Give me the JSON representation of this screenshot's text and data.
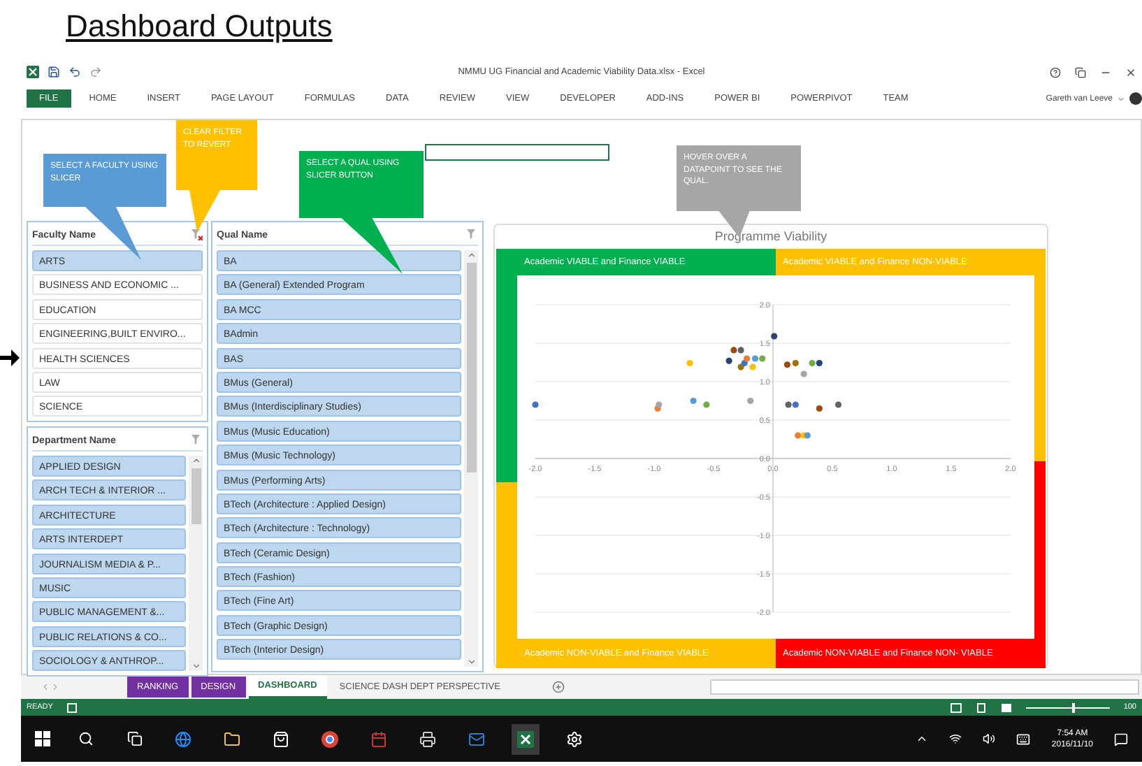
{
  "slide_title": "Dashboard Outputs",
  "window": {
    "title": "NMMU UG Financial and Academic Viability Data.xlsx - Excel",
    "user": "Gareth van Leeve"
  },
  "ribbon_tabs": [
    {
      "label": "FILE",
      "selected": true
    },
    {
      "label": "HOME",
      "selected": false
    },
    {
      "label": "INSERT",
      "selected": false
    },
    {
      "label": "PAGE LAYOUT",
      "selected": false
    },
    {
      "label": "FORMULAS",
      "selected": false
    },
    {
      "label": "DATA",
      "selected": false
    },
    {
      "label": "REVIEW",
      "selected": false
    },
    {
      "label": "VIEW",
      "selected": false
    },
    {
      "label": "DEVELOPER",
      "selected": false
    },
    {
      "label": "ADD-INS",
      "selected": false
    },
    {
      "label": "POWER BI",
      "selected": false
    },
    {
      "label": "POWERPIVOT",
      "selected": false
    },
    {
      "label": "TEAM",
      "selected": false
    }
  ],
  "callouts": [
    {
      "text": "SELECT A FACULTY USING SLICER",
      "color": "#5b9bd5"
    },
    {
      "text": "CLEAR FILTER TO REVERT",
      "color": "#ffc000"
    },
    {
      "text": "SELECT A QUAL USING SLICER BUTTON",
      "color": "#00b050"
    },
    {
      "text": "HOVER OVER A DATAPOINT TO SEE THE QUAL.",
      "color": "#a6a6a6"
    }
  ],
  "slicers": [
    {
      "title": "Faculty Name",
      "filtered": true,
      "scrollable": false,
      "items": [
        {
          "label": "ARTS",
          "selected": true
        },
        {
          "label": "BUSINESS AND ECONOMIC ...",
          "selected": false
        },
        {
          "label": "EDUCATION",
          "selected": false
        },
        {
          "label": "ENGINEERING,BUILT ENVIRO...",
          "selected": false
        },
        {
          "label": "HEALTH SCIENCES",
          "selected": false
        },
        {
          "label": "LAW",
          "selected": false
        },
        {
          "label": "SCIENCE",
          "selected": false
        }
      ]
    },
    {
      "title": "Department Name",
      "filtered": false,
      "scrollable": true,
      "items": [
        {
          "label": "APPLIED DESIGN",
          "selected": true
        },
        {
          "label": "ARCH TECH & INTERIOR ...",
          "selected": true
        },
        {
          "label": "ARCHITECTURE",
          "selected": true
        },
        {
          "label": "ARTS INTERDEPT",
          "selected": true
        },
        {
          "label": "JOURNALISM MEDIA & P...",
          "selected": true
        },
        {
          "label": "MUSIC",
          "selected": true
        },
        {
          "label": "PUBLIC MANAGEMENT &...",
          "selected": true
        },
        {
          "label": "PUBLIC RELATIONS & CO...",
          "selected": true
        },
        {
          "label": "SOCIOLOGY & ANTHROP...",
          "selected": true
        }
      ]
    },
    {
      "title": "Qual Name",
      "filtered": false,
      "scrollable": true,
      "items": [
        {
          "label": "BA",
          "selected": true
        },
        {
          "label": "BA (General) Extended Program",
          "selected": true
        },
        {
          "label": "BA MCC",
          "selected": true
        },
        {
          "label": "BAdmin",
          "selected": true
        },
        {
          "label": "BAS",
          "selected": true
        },
        {
          "label": "BMus (General)",
          "selected": true
        },
        {
          "label": "BMus (Interdisciplinary Studies)",
          "selected": true
        },
        {
          "label": "BMus (Music Education)",
          "selected": true
        },
        {
          "label": "BMus (Music Technology)",
          "selected": true
        },
        {
          "label": "BMus (Performing Arts)",
          "selected": true
        },
        {
          "label": "BTech (Architecture : Applied Design)",
          "selected": true
        },
        {
          "label": "BTech (Architecture : Technology)",
          "selected": true
        },
        {
          "label": "BTech (Ceramic Design)",
          "selected": true
        },
        {
          "label": "BTech (Fashion)",
          "selected": true
        },
        {
          "label": "BTech (Fine Art)",
          "selected": true
        },
        {
          "label": "BTech (Graphic Design)",
          "selected": true
        },
        {
          "label": "BTech (Interior Design)",
          "selected": true
        }
      ]
    }
  ],
  "chart": {
    "quadrants": [
      {
        "label": "Academic VIABLE and Finance VIABLE",
        "color": "#00b050"
      },
      {
        "label": "Academic VIABLE and Finance NON-VIABLE",
        "color": "#ffc000"
      },
      {
        "label": "Academic NON-VIABLE and Finance VIABLE",
        "color": "#ffc000"
      },
      {
        "label": "Academic NON-VIABLE and Finance NON- VIABLE",
        "color": "#ff0000"
      }
    ],
    "chart_data": {
      "type": "scatter",
      "title": "Programme Viability",
      "x": [
        -2.0,
        -0.97,
        -0.96,
        -0.7,
        -0.67,
        -0.56,
        -0.37,
        -0.33,
        -0.27,
        -0.27,
        -0.24,
        -0.22,
        -0.19,
        -0.17,
        -0.15,
        -0.09,
        0.01,
        0.12,
        0.13,
        0.19,
        0.19,
        0.21,
        0.26,
        0.26,
        0.29,
        0.33,
        0.39,
        0.39,
        0.55
      ],
      "series": [
        {
          "values": [
            0.7,
            0.65,
            0.7,
            1.24,
            0.75,
            0.7,
            1.27,
            1.41,
            1.41,
            1.19,
            1.24,
            1.3,
            0.75,
            1.19,
            1.3,
            1.3,
            1.59,
            1.22,
            0.7,
            1.24,
            0.7,
            0.3,
            1.1,
            0.3,
            0.3,
            1.24,
            1.24,
            0.65,
            0.7
          ]
        }
      ],
      "xlim": [
        -2,
        2
      ],
      "ylim": [
        -2,
        2
      ],
      "grid": true,
      "xticks": [
        {
          "value": -2,
          "label": "-2.0"
        },
        {
          "value": -1.5,
          "label": "-1.5"
        },
        {
          "value": -1,
          "label": "-1.0"
        },
        {
          "value": -0.5,
          "label": "-0.5"
        },
        {
          "value": 0,
          "label": "0.0"
        },
        {
          "value": 0.5,
          "label": "0.5"
        },
        {
          "value": 1,
          "label": "1.0"
        },
        {
          "value": 1.5,
          "label": "1.5"
        },
        {
          "value": 2,
          "label": "2.0"
        }
      ],
      "yticks": [
        {
          "value": -2,
          "label": "-2.0"
        },
        {
          "value": -1.5,
          "label": "-1.5"
        },
        {
          "value": -1,
          "label": "-1.0"
        },
        {
          "value": -0.5,
          "label": "-0.5"
        },
        {
          "value": 0,
          "label": "0.0"
        },
        {
          "value": 0.5,
          "label": "0.5"
        },
        {
          "value": 1,
          "label": "1.0"
        },
        {
          "value": 1.5,
          "label": "1.5"
        },
        {
          "value": 2,
          "label": "2.0"
        }
      ]
    }
  },
  "sheet_tabs": [
    {
      "label": "RANKING",
      "selected": false,
      "color": "#7030a0"
    },
    {
      "label": "DESIGN",
      "selected": false,
      "color": "#7030a0"
    },
    {
      "label": "DASHBOARD",
      "selected": true
    },
    {
      "label": "SCIENCE DASH DEPT PERSPECTIVE",
      "selected": false
    }
  ],
  "status": {
    "text": "READY",
    "zoom": "100",
    "zoom_slider": {
      "level": 0.57
    }
  },
  "taskbar": {
    "time": "7:54 AM",
    "date": "2016/11/10"
  }
}
